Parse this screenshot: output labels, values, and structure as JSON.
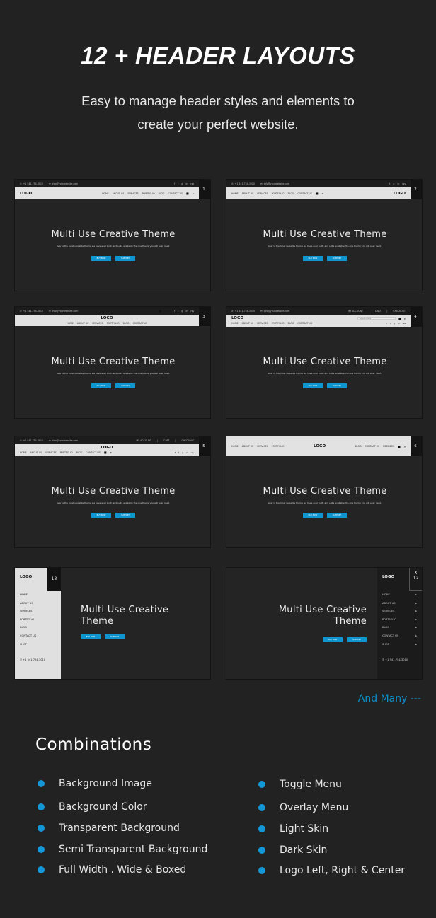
{
  "header": {
    "title": "12 + HEADER LAYOUTS",
    "subtitle_lines": [
      "Easy to manage header styles and elements to",
      "create your perfect website."
    ]
  },
  "common": {
    "logo": "LOGO",
    "phone": "+1 541-754-3010",
    "email": "info@yourwebsite.com",
    "hero_title": "Multi Use Creative Theme",
    "hero_text": "Aver is the most versatile theme we have ever built, and suits available the one theme you will ever need.",
    "buy_now": "BUY NOW",
    "support": "SUPPORT",
    "search_placeholder": "Search in here",
    "account_links": [
      "MY ACCOUNT",
      "|",
      "CART",
      "|",
      "CHECKOUT"
    ],
    "socials": [
      "f",
      "t",
      "g",
      "in",
      "rss"
    ],
    "nav": [
      "HOME",
      "ABOUT US",
      "SERVICES",
      "PORTFOLIO",
      "BLOG",
      "CONTACT US"
    ],
    "nav_split_left": [
      "HOME",
      "ABOUT US",
      "SERVICES",
      "PORTFOLIO"
    ],
    "nav_split_right": [
      "BLOG",
      "CONTACT US",
      "MEMBERS"
    ],
    "side_nav": [
      "HOME",
      "ABOUT US",
      "SERVICES",
      "PORTFOLIO",
      "BLOG",
      "CONTACT US",
      "SHOP"
    ],
    "close_mark": "x"
  },
  "layouts": [
    {
      "number": "1",
      "style": "logo-left"
    },
    {
      "number": "2",
      "style": "logo-right"
    },
    {
      "number": "3",
      "style": "logo-center-stacked"
    },
    {
      "number": "4",
      "style": "two-row-search"
    },
    {
      "number": "5",
      "style": "logo-center-account"
    },
    {
      "number": "6",
      "style": "logo-center-split"
    },
    {
      "number": "13",
      "style": "sidebar-left"
    },
    {
      "number": "12",
      "style": "sidebar-right"
    }
  ],
  "more_text": "And Many ---",
  "combinations": {
    "title": "Combinations",
    "left": [
      "Background Image",
      "Background Color",
      "Transparent  Background",
      "Semi Transparent  Background",
      "Full Width . Wide  & Boxed"
    ],
    "right": [
      "Toggle Menu",
      "Overlay Menu",
      "Light Skin",
      "Dark Skin",
      "Logo Left, Right & Center"
    ]
  },
  "colors": {
    "accent": "#0f95cf",
    "background": "#222222",
    "header_light": "#e2e2e2"
  }
}
